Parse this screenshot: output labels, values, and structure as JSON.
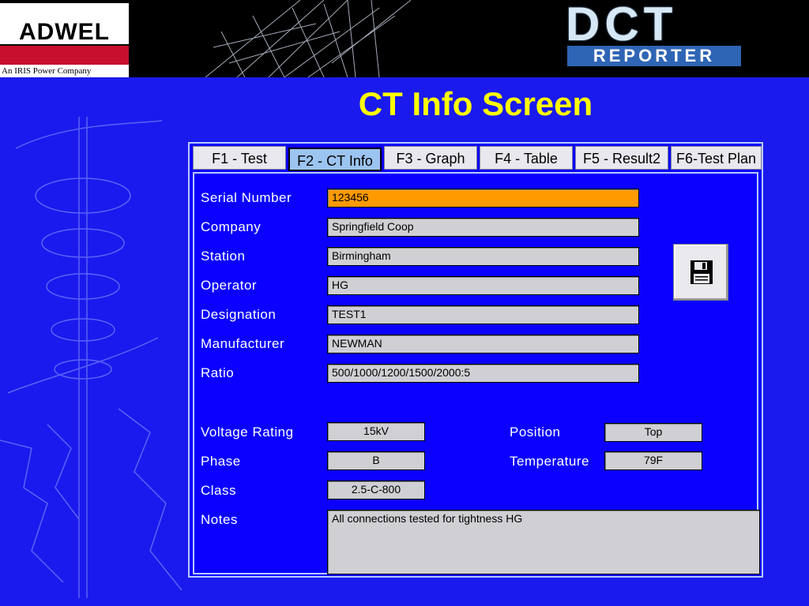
{
  "header": {
    "company_logo": "ADWEL",
    "company_tagline": "An IRIS Power Company",
    "product_logo_main": "DCT",
    "product_logo_sub": "REPORTER"
  },
  "page_title": "CT Info Screen",
  "tabs": [
    {
      "label": "F1 - Test",
      "active": false
    },
    {
      "label": "F2 - CT Info",
      "active": true
    },
    {
      "label": "F3 - Graph",
      "active": false
    },
    {
      "label": "F4 - Table",
      "active": false
    },
    {
      "label": "F5 - Result2",
      "active": false
    },
    {
      "label": "F6-Test Plan",
      "active": false
    }
  ],
  "form": {
    "serial_number": {
      "label": "Serial Number",
      "value": "123456"
    },
    "company": {
      "label": "Company",
      "value": "Springfield Coop"
    },
    "station": {
      "label": "Station",
      "value": "Birmingham"
    },
    "operator": {
      "label": "Operator",
      "value": "HG"
    },
    "designation": {
      "label": "Designation",
      "value": "TEST1"
    },
    "manufacturer": {
      "label": "Manufacturer",
      "value": "NEWMAN"
    },
    "ratio": {
      "label": "Ratio",
      "value": "500/1000/1200/1500/2000:5"
    },
    "voltage_rating": {
      "label": "Voltage Rating",
      "value": "15kV"
    },
    "phase": {
      "label": "Phase",
      "value": "B"
    },
    "class": {
      "label": "Class",
      "value": "2.5-C-800"
    },
    "position": {
      "label": "Position",
      "value": "Top"
    },
    "temperature": {
      "label": "Temperature",
      "value": "79F"
    },
    "notes": {
      "label": "Notes",
      "value": "All connections tested for tightness HG"
    }
  },
  "colors": {
    "background": "#1a1aee",
    "title": "#ffff00",
    "highlight_field": "#ff9a00",
    "active_tab": "#9cc4f0",
    "brand_red": "#c8102e"
  },
  "icons": {
    "save": "floppy-disk-icon"
  }
}
